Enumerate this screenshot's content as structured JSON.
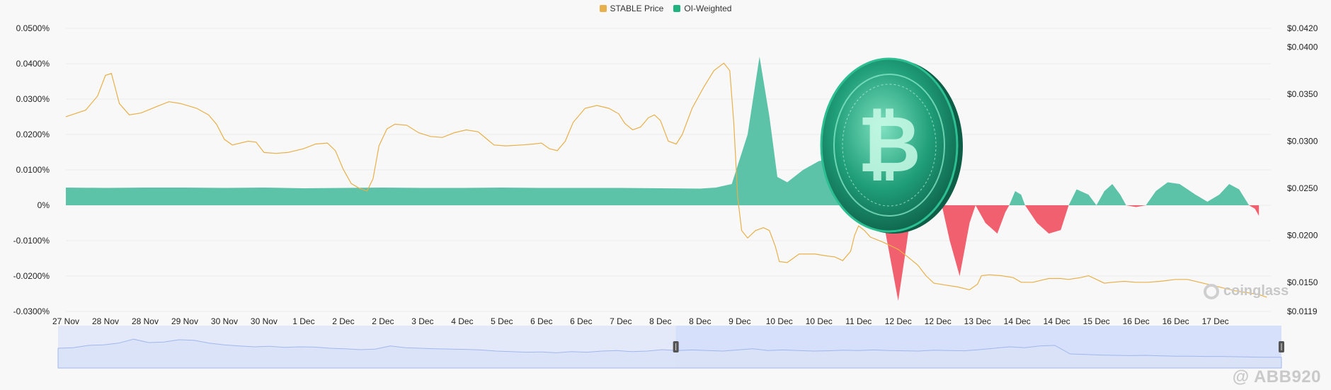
{
  "legend": {
    "price_label": "STABLE Price",
    "oi_label": "OI-Weighted"
  },
  "colors": {
    "price": "#e8b04a",
    "positive": "#5cc2a8",
    "negative": "#f0606e",
    "navigator_line": "#9bb2ee",
    "navigator_fill": "#e4e9fa",
    "navigator_selected": "#d6e0fa",
    "grid": "#ececec",
    "axis_text": "#222222"
  },
  "brand": "coinglass",
  "watermark": "@ ABB920",
  "chart_data": {
    "type": "area",
    "x_labels": [
      "27 Nov",
      "28 Nov",
      "28 Nov",
      "29 Nov",
      "30 Nov",
      "30 Nov",
      "1 Dec",
      "2 Dec",
      "2 Dec",
      "3 Dec",
      "4 Dec",
      "5 Dec",
      "6 Dec",
      "6 Dec",
      "7 Dec",
      "8 Dec",
      "8 Dec",
      "9 Dec",
      "10 Dec",
      "10 Dec",
      "11 Dec",
      "12 Dec",
      "12 Dec",
      "13 Dec",
      "14 Dec",
      "14 Dec",
      "15 Dec",
      "16 Dec",
      "16 Dec",
      "17 Dec"
    ],
    "y_left": {
      "ticks": [
        "0.0500%",
        "0.0400%",
        "0.0300%",
        "0.0200%",
        "0.0100%",
        "0%",
        "-0.0100%",
        "-0.0200%",
        "-0.0300%"
      ],
      "range": [
        -0.03,
        0.05
      ]
    },
    "y_right": {
      "ticks": [
        "$0.0420",
        "$0.0400",
        "$0.0350",
        "$0.0300",
        "$0.0250",
        "$0.0200",
        "$0.0150",
        "$0.0119"
      ],
      "tick_values": [
        0.042,
        0.04,
        0.035,
        0.03,
        0.025,
        0.02,
        0.015,
        0.0119
      ],
      "range": [
        0.0119,
        0.042
      ]
    },
    "x_index_range": [
      0,
      30.4
    ],
    "series": [
      {
        "name": "OI-Weighted",
        "type": "area",
        "unit": "%",
        "points": [
          [
            0,
            0.005
          ],
          [
            1,
            0.0049
          ],
          [
            2,
            0.005
          ],
          [
            3,
            0.005
          ],
          [
            4,
            0.0049
          ],
          [
            5,
            0.005
          ],
          [
            6,
            0.0048
          ],
          [
            7,
            0.0049
          ],
          [
            8,
            0.005
          ],
          [
            9,
            0.0049
          ],
          [
            10,
            0.0049
          ],
          [
            11,
            0.005
          ],
          [
            12,
            0.0049
          ],
          [
            13,
            0.0049
          ],
          [
            14,
            0.0049
          ],
          [
            15,
            0.0048
          ],
          [
            16,
            0.0047
          ],
          [
            16.4,
            0.005
          ],
          [
            16.8,
            0.006
          ],
          [
            17.2,
            0.02
          ],
          [
            17.5,
            0.042
          ],
          [
            17.75,
            0.025
          ],
          [
            17.95,
            0.008
          ],
          [
            18.2,
            0.0065
          ],
          [
            18.6,
            0.01
          ],
          [
            19.0,
            0.0125
          ],
          [
            19.4,
            0.013
          ],
          [
            19.8,
            0.01
          ],
          [
            20.1,
            0.004
          ],
          [
            20.3,
            0.001
          ],
          [
            20.55,
            0.0
          ],
          [
            20.8,
            -0.015
          ],
          [
            21.0,
            -0.027
          ],
          [
            21.2,
            -0.012
          ],
          [
            21.35,
            0.0
          ],
          [
            21.6,
            0.006
          ],
          [
            21.9,
            0.006
          ],
          [
            22.1,
            0.0
          ],
          [
            22.3,
            -0.01
          ],
          [
            22.55,
            -0.02
          ],
          [
            22.8,
            -0.005
          ],
          [
            22.95,
            0.0
          ],
          [
            23.2,
            -0.005
          ],
          [
            23.5,
            -0.008
          ],
          [
            23.7,
            -0.002
          ],
          [
            23.8,
            0.0
          ],
          [
            23.95,
            0.004
          ],
          [
            24.1,
            0.003
          ],
          [
            24.2,
            0.0
          ],
          [
            24.5,
            -0.005
          ],
          [
            24.8,
            -0.008
          ],
          [
            25.1,
            -0.007
          ],
          [
            25.3,
            0.0
          ],
          [
            25.5,
            0.0045
          ],
          [
            25.8,
            0.003
          ],
          [
            26.0,
            0.0
          ],
          [
            26.2,
            0.004
          ],
          [
            26.4,
            0.006
          ],
          [
            26.6,
            0.003
          ],
          [
            26.75,
            0.0
          ],
          [
            27.0,
            -0.0005
          ],
          [
            27.25,
            0.0
          ],
          [
            27.5,
            0.004
          ],
          [
            27.8,
            0.0065
          ],
          [
            28.1,
            0.006
          ],
          [
            28.5,
            0.003
          ],
          [
            28.8,
            0.001
          ],
          [
            29.1,
            0.003
          ],
          [
            29.35,
            0.006
          ],
          [
            29.6,
            0.0045
          ],
          [
            29.85,
            0.0
          ],
          [
            30.0,
            -0.001
          ],
          [
            30.1,
            -0.003
          ]
        ]
      },
      {
        "name": "STABLE Price",
        "type": "line",
        "unit": "$",
        "points": [
          [
            0,
            0.0326
          ],
          [
            0.5,
            0.0333
          ],
          [
            0.8,
            0.0348
          ],
          [
            1.0,
            0.037
          ],
          [
            1.15,
            0.0372
          ],
          [
            1.35,
            0.034
          ],
          [
            1.6,
            0.0328
          ],
          [
            1.9,
            0.033
          ],
          [
            2.3,
            0.0337
          ],
          [
            2.6,
            0.0342
          ],
          [
            2.9,
            0.034
          ],
          [
            3.3,
            0.0335
          ],
          [
            3.6,
            0.0328
          ],
          [
            3.8,
            0.0318
          ],
          [
            4.0,
            0.0302
          ],
          [
            4.2,
            0.0296
          ],
          [
            4.6,
            0.03
          ],
          [
            4.8,
            0.0299
          ],
          [
            5.0,
            0.0288
          ],
          [
            5.3,
            0.0287
          ],
          [
            5.6,
            0.0288
          ],
          [
            6.0,
            0.0292
          ],
          [
            6.3,
            0.0297
          ],
          [
            6.6,
            0.0298
          ],
          [
            6.8,
            0.029
          ],
          [
            7.0,
            0.027
          ],
          [
            7.2,
            0.0255
          ],
          [
            7.4,
            0.025
          ],
          [
            7.6,
            0.0247
          ],
          [
            7.75,
            0.026
          ],
          [
            7.9,
            0.0295
          ],
          [
            8.1,
            0.0313
          ],
          [
            8.3,
            0.0318
          ],
          [
            8.6,
            0.0317
          ],
          [
            8.9,
            0.0309
          ],
          [
            9.2,
            0.0305
          ],
          [
            9.5,
            0.0304
          ],
          [
            9.8,
            0.0309
          ],
          [
            10.1,
            0.0312
          ],
          [
            10.4,
            0.031
          ],
          [
            10.6,
            0.0303
          ],
          [
            10.8,
            0.0296
          ],
          [
            11.1,
            0.0295
          ],
          [
            11.5,
            0.0296
          ],
          [
            11.8,
            0.0297
          ],
          [
            12.0,
            0.0298
          ],
          [
            12.2,
            0.0292
          ],
          [
            12.4,
            0.029
          ],
          [
            12.6,
            0.03
          ],
          [
            12.8,
            0.032
          ],
          [
            13.1,
            0.0335
          ],
          [
            13.4,
            0.0338
          ],
          [
            13.7,
            0.0335
          ],
          [
            13.95,
            0.0329
          ],
          [
            14.1,
            0.0319
          ],
          [
            14.3,
            0.0312
          ],
          [
            14.5,
            0.0315
          ],
          [
            14.7,
            0.0325
          ],
          [
            14.85,
            0.0328
          ],
          [
            15.0,
            0.0322
          ],
          [
            15.2,
            0.03
          ],
          [
            15.4,
            0.0297
          ],
          [
            15.55,
            0.0307
          ],
          [
            15.8,
            0.0335
          ],
          [
            16.1,
            0.0358
          ],
          [
            16.35,
            0.0375
          ],
          [
            16.6,
            0.0383
          ],
          [
            16.75,
            0.0375
          ],
          [
            16.85,
            0.032
          ],
          [
            16.95,
            0.024
          ],
          [
            17.05,
            0.0205
          ],
          [
            17.2,
            0.0197
          ],
          [
            17.4,
            0.0205
          ],
          [
            17.6,
            0.0208
          ],
          [
            17.75,
            0.0205
          ],
          [
            17.9,
            0.0188
          ],
          [
            18.0,
            0.0172
          ],
          [
            18.2,
            0.0171
          ],
          [
            18.5,
            0.018
          ],
          [
            18.9,
            0.018
          ],
          [
            19.2,
            0.0178
          ],
          [
            19.4,
            0.0177
          ],
          [
            19.6,
            0.0173
          ],
          [
            19.8,
            0.0183
          ],
          [
            19.9,
            0.02
          ],
          [
            20.0,
            0.021
          ],
          [
            20.15,
            0.0205
          ],
          [
            20.3,
            0.0198
          ],
          [
            20.6,
            0.0193
          ],
          [
            21.0,
            0.0185
          ],
          [
            21.3,
            0.0175
          ],
          [
            21.5,
            0.0168
          ],
          [
            21.7,
            0.0157
          ],
          [
            21.9,
            0.0149
          ],
          [
            22.2,
            0.0147
          ],
          [
            22.5,
            0.0145
          ],
          [
            22.8,
            0.0142
          ],
          [
            23.0,
            0.0148
          ],
          [
            23.1,
            0.0157
          ],
          [
            23.3,
            0.0158
          ],
          [
            23.6,
            0.0157
          ],
          [
            23.9,
            0.0155
          ],
          [
            24.1,
            0.015
          ],
          [
            24.4,
            0.015
          ],
          [
            24.6,
            0.0152
          ],
          [
            24.8,
            0.0154
          ],
          [
            25.1,
            0.0154
          ],
          [
            25.3,
            0.0153
          ],
          [
            25.6,
            0.0155
          ],
          [
            25.8,
            0.0157
          ],
          [
            26.0,
            0.0153
          ],
          [
            26.2,
            0.0149
          ],
          [
            26.4,
            0.015
          ],
          [
            26.7,
            0.0151
          ],
          [
            27.0,
            0.015
          ],
          [
            27.3,
            0.015
          ],
          [
            27.6,
            0.0151
          ],
          [
            28.0,
            0.0153
          ],
          [
            28.3,
            0.0153
          ],
          [
            28.6,
            0.015
          ],
          [
            28.9,
            0.0147
          ],
          [
            29.2,
            0.0144
          ],
          [
            29.5,
            0.0141
          ],
          [
            29.8,
            0.0139
          ],
          [
            30.1,
            0.0137
          ],
          [
            30.3,
            0.0134
          ]
        ]
      }
    ],
    "navigator": {
      "selected_range": [
        0.505,
        1.0
      ],
      "profile": [
        0.5,
        0.52,
        0.6,
        0.62,
        0.68,
        0.82,
        0.7,
        0.72,
        0.8,
        0.78,
        0.68,
        0.62,
        0.58,
        0.55,
        0.57,
        0.53,
        0.55,
        0.54,
        0.5,
        0.48,
        0.45,
        0.47,
        0.58,
        0.52,
        0.5,
        0.48,
        0.47,
        0.46,
        0.44,
        0.4,
        0.38,
        0.36,
        0.37,
        0.34,
        0.38,
        0.36,
        0.4,
        0.42,
        0.38,
        0.4,
        0.45,
        0.42,
        0.44,
        0.42,
        0.4,
        0.44,
        0.48,
        0.42,
        0.44,
        0.42,
        0.4,
        0.41,
        0.43,
        0.42,
        0.44,
        0.42,
        0.41,
        0.4,
        0.43,
        0.42,
        0.41,
        0.45,
        0.5,
        0.55,
        0.52,
        0.58,
        0.6,
        0.3,
        0.28,
        0.26,
        0.25,
        0.24,
        0.25,
        0.23,
        0.22,
        0.22,
        0.21,
        0.21,
        0.2,
        0.19,
        0.18,
        0.18
      ]
    }
  }
}
